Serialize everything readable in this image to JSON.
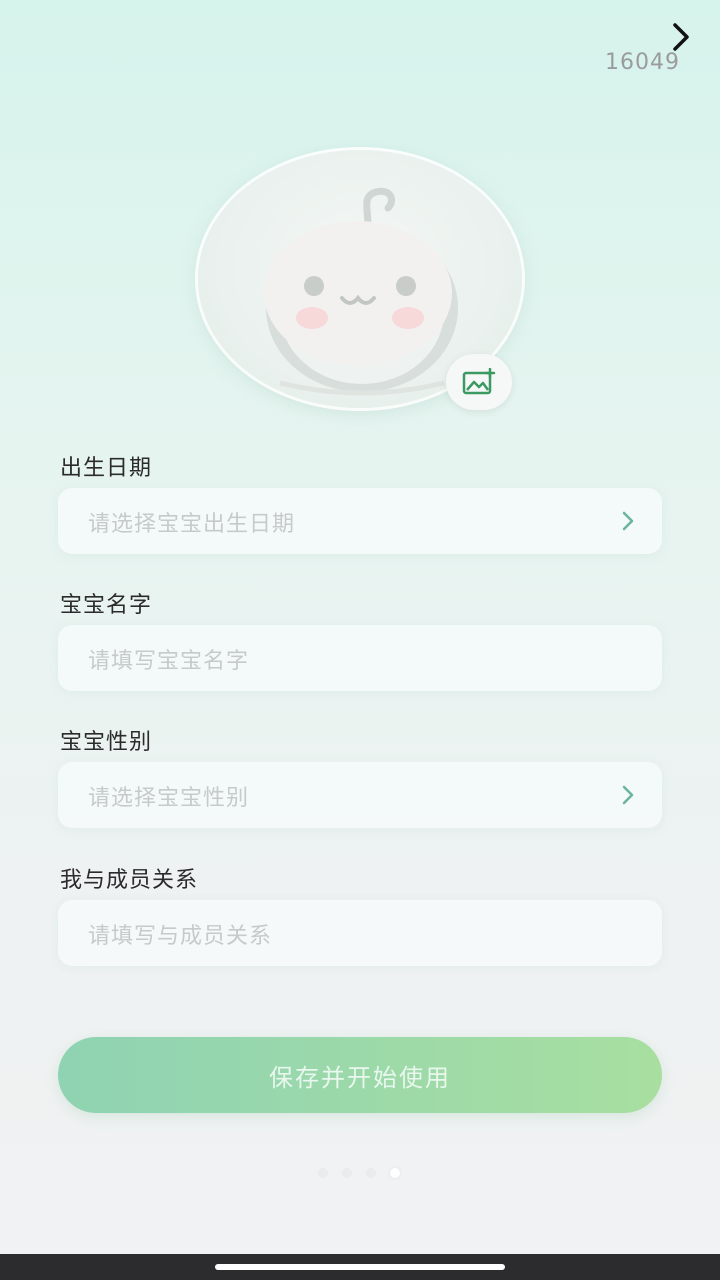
{
  "header": {
    "count": "16049"
  },
  "form": {
    "birthdate": {
      "label": "出生日期",
      "placeholder": "请选择宝宝出生日期"
    },
    "name": {
      "label": "宝宝名字",
      "placeholder": "请填写宝宝名字"
    },
    "gender": {
      "label": "宝宝性别",
      "placeholder": "请选择宝宝性别"
    },
    "relation": {
      "label": "我与成员关系",
      "placeholder": "请填写与成员关系"
    }
  },
  "actions": {
    "save_label": "保存并开始使用"
  },
  "pagination": {
    "total": 4,
    "active": 4
  },
  "colors": {
    "accent_start": "#8fd3b3",
    "accent_end": "#a8dfa0",
    "icon_green": "#3a9a62"
  },
  "icons": {
    "next": "chevron-right-icon",
    "avatar": "baby-avatar-icon",
    "add_photo": "add-photo-icon",
    "field_arrow": "chevron-right-icon"
  }
}
